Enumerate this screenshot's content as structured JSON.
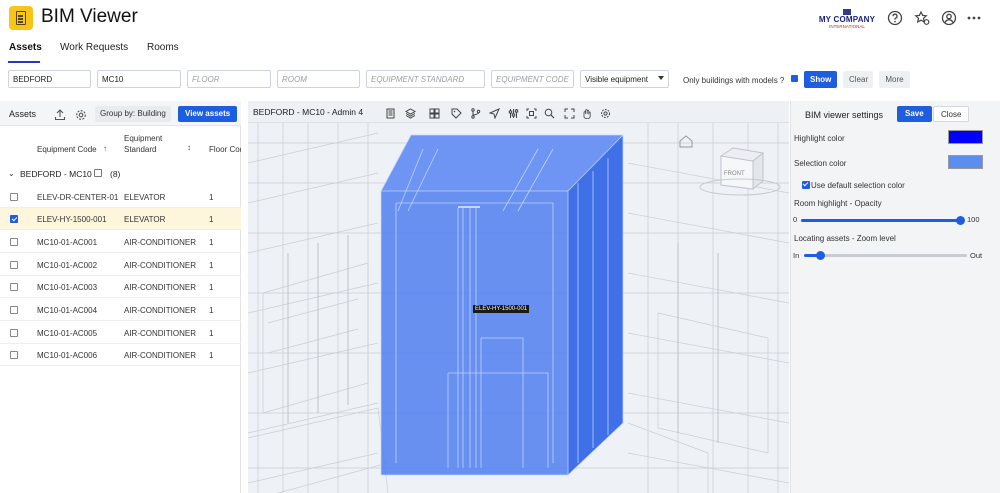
{
  "app": {
    "title": "BIM Viewer"
  },
  "company": {
    "name": "MY COMPANY",
    "sub": "INTERNATIONAL"
  },
  "header_icons": [
    "help-icon",
    "favorites-icon",
    "user-icon",
    "more-icon"
  ],
  "tabs": [
    {
      "label": "Assets",
      "active": true
    },
    {
      "label": "Work Requests",
      "active": false
    },
    {
      "label": "Rooms",
      "active": false
    }
  ],
  "filters": {
    "building": {
      "value": "BEDFORD",
      "placeholder": ""
    },
    "floor_code": {
      "value": "MC10",
      "placeholder": ""
    },
    "floor": {
      "value": "",
      "placeholder": "FLOOR"
    },
    "room": {
      "value": "",
      "placeholder": "ROOM"
    },
    "equipment_standard": {
      "value": "",
      "placeholder": "EQUIPMENT STANDARD"
    },
    "equipment_code": {
      "value": "",
      "placeholder": "EQUIPMENT CODE"
    },
    "visibility": {
      "selected": "Visible equipment"
    },
    "only_buildings_label": "Only buildings with models ?",
    "only_buildings_checked": true,
    "show_label": "Show",
    "clear_label": "Clear",
    "more_label": "More"
  },
  "assets_panel": {
    "title": "Assets",
    "group_by_label": "Group by: Building",
    "view_assets_label": "View assets",
    "columns": {
      "code": "Equipment Code",
      "standard_line1": "Equipment",
      "standard_line2": "Standard",
      "floor": "Floor Cod"
    },
    "group": {
      "label": "BEDFORD - MC10",
      "count": "(8)"
    },
    "rows": [
      {
        "code": "ELEV-DR-CENTER-01",
        "standard": "ELEVATOR",
        "floor": "1",
        "checked": false
      },
      {
        "code": "ELEV-HY-1500-001",
        "standard": "ELEVATOR",
        "floor": "1",
        "checked": true
      },
      {
        "code": "MC10-01-AC001",
        "standard": "AIR-CONDITIONER",
        "floor": "1",
        "checked": false
      },
      {
        "code": "MC10-01-AC002",
        "standard": "AIR-CONDITIONER",
        "floor": "1",
        "checked": false
      },
      {
        "code": "MC10-01-AC003",
        "standard": "AIR-CONDITIONER",
        "floor": "1",
        "checked": false
      },
      {
        "code": "MC10-01-AC004",
        "standard": "AIR-CONDITIONER",
        "floor": "1",
        "checked": false
      },
      {
        "code": "MC10-01-AC005",
        "standard": "AIR-CONDITIONER",
        "floor": "1",
        "checked": false
      },
      {
        "code": "MC10-01-AC006",
        "standard": "AIR-CONDITIONER",
        "floor": "1",
        "checked": false
      }
    ]
  },
  "viewer": {
    "title": "BEDFORD - MC10 - Admin 4",
    "toolbar_icons": [
      "layers-icon",
      "model-icon",
      "grid-icon",
      "tag-icon",
      "branch-icon",
      "navigate-icon",
      "sliders-icon",
      "crop-icon",
      "zoom-icon",
      "fullscreen-icon",
      "pan-icon",
      "settings-icon"
    ],
    "selected_label": "ELEV-HY-1500-001",
    "cube_label": "FRONT"
  },
  "settings": {
    "title": "BIM viewer settings",
    "save_label": "Save",
    "close_label": "Close",
    "highlight_label": "Highlight color",
    "highlight_color": "#0000ff",
    "selection_label": "Selection color",
    "selection_color": "#5b8ef0",
    "use_default_label": "Use default selection color",
    "use_default_checked": true,
    "opacity_label": "Room highlight - Opacity",
    "opacity_min": "0",
    "opacity_max": "100",
    "opacity_value": 100,
    "zoom_label": "Locating assets - Zoom level",
    "zoom_min": "In",
    "zoom_max": "Out",
    "zoom_value": 0.1
  }
}
